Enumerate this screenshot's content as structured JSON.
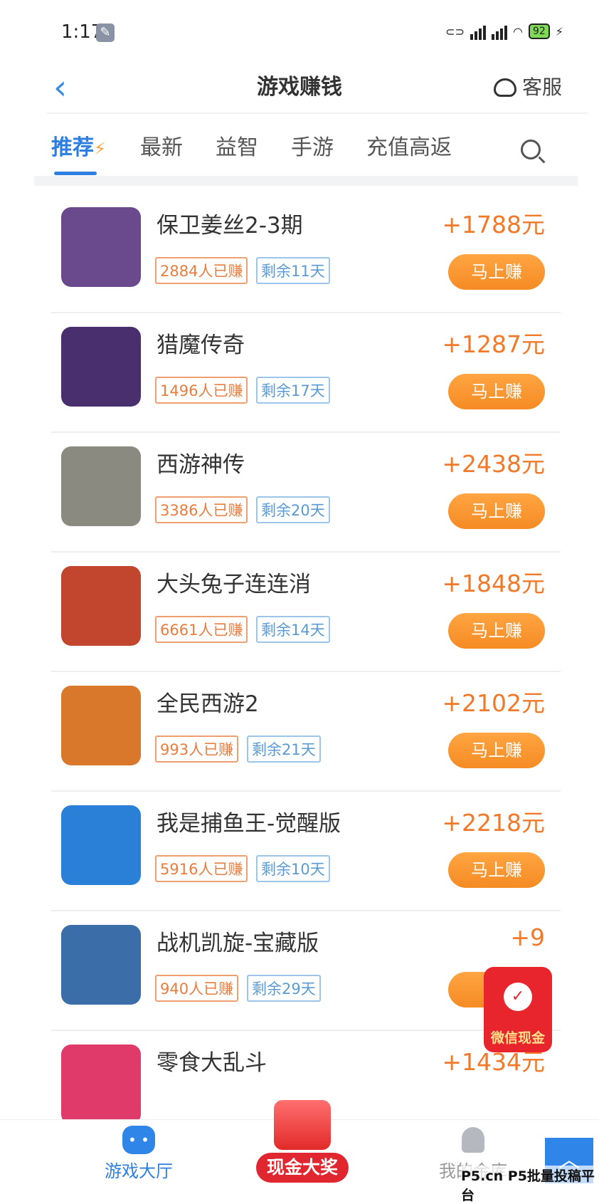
{
  "status_bar": {
    "time": "1:17",
    "battery": "92"
  },
  "header": {
    "title": "游戏赚钱",
    "service_label": "客服"
  },
  "tabs": [
    {
      "label": "推荐"
    },
    {
      "label": "最新"
    },
    {
      "label": "益智"
    },
    {
      "label": "手游"
    },
    {
      "label": "充值高返"
    }
  ],
  "games": [
    {
      "name": "保卫姜丝2-3期",
      "earned": "2884人已赚",
      "remaining": "剩余11天",
      "reward": "+1788元",
      "button": "马上赚",
      "color": "#6a4a8c"
    },
    {
      "name": "猎魔传奇",
      "earned": "1496人已赚",
      "remaining": "剩余17天",
      "reward": "+1287元",
      "button": "马上赚",
      "color": "#4a2f6e"
    },
    {
      "name": "西游神传",
      "earned": "3386人已赚",
      "remaining": "剩余20天",
      "reward": "+2438元",
      "button": "马上赚",
      "color": "#8a8a80"
    },
    {
      "name": "大头兔子连连消",
      "earned": "6661人已赚",
      "remaining": "剩余14天",
      "reward": "+1848元",
      "button": "马上赚",
      "color": "#c2452d"
    },
    {
      "name": "全民西游2",
      "earned": "993人已赚",
      "remaining": "剩余21天",
      "reward": "+2102元",
      "button": "马上赚",
      "color": "#d9772b"
    },
    {
      "name": "我是捕鱼王-觉醒版",
      "earned": "5916人已赚",
      "remaining": "剩余10天",
      "reward": "+2218元",
      "button": "马上赚",
      "color": "#2a7fd6"
    },
    {
      "name": "战机凯旋-宝藏版",
      "earned": "940人已赚",
      "remaining": "剩余29天",
      "reward": "+9",
      "button": "马",
      "color": "#3b6ea8"
    },
    {
      "name": "零食大乱斗",
      "earned": "",
      "remaining": "",
      "reward": "+1434元",
      "button": "",
      "color": "#e03a6a"
    }
  ],
  "floating": {
    "red_packet_label": "微信现金"
  },
  "bottom_nav": {
    "hall": "游戏大厅",
    "center": "现金大奖",
    "mine": "我的金库",
    "watermark": "P5.cn P5批量投稿平台"
  }
}
